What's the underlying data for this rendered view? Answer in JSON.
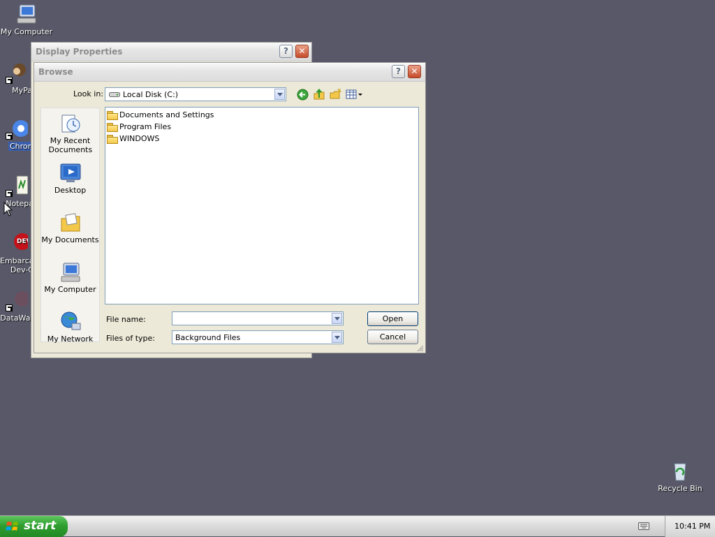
{
  "desktop": {
    "icons": [
      {
        "label": "My Computer"
      },
      {
        "label": "MyPa"
      },
      {
        "label": "Chrom"
      },
      {
        "label": "Notepa"
      },
      {
        "label": "Embarca\nDev-C"
      },
      {
        "label": "DataWar"
      },
      {
        "label": "Recycle Bin"
      }
    ]
  },
  "display_properties": {
    "title": "Display Properties",
    "help_label": "?",
    "close_label": "✕"
  },
  "browse": {
    "title": "Browse",
    "help_label": "?",
    "close_label": "✕",
    "look_in_label": "Look in:",
    "look_in_value": "Local Disk (C:)",
    "places": [
      {
        "label": "My Recent Documents",
        "icon": "recent-documents-icon"
      },
      {
        "label": "Desktop",
        "icon": "desktop-icon"
      },
      {
        "label": "My Documents",
        "icon": "my-documents-icon"
      },
      {
        "label": "My Computer",
        "icon": "my-computer-icon"
      },
      {
        "label": "My Network",
        "icon": "my-network-icon"
      }
    ],
    "files": [
      {
        "name": "Documents and Settings"
      },
      {
        "name": "Program Files"
      },
      {
        "name": "WINDOWS"
      }
    ],
    "file_name_label": "File name:",
    "file_name_value": "",
    "files_of_type_label": "Files of type:",
    "files_of_type_value": "Background Files",
    "open_label": "Open",
    "cancel_label": "Cancel"
  },
  "taskbar": {
    "start_label": "start",
    "clock": "10:41 PM"
  },
  "colors": {
    "desktop": "#585868",
    "start_green": "#2f9e2f",
    "close_red": "#c64c2a"
  }
}
